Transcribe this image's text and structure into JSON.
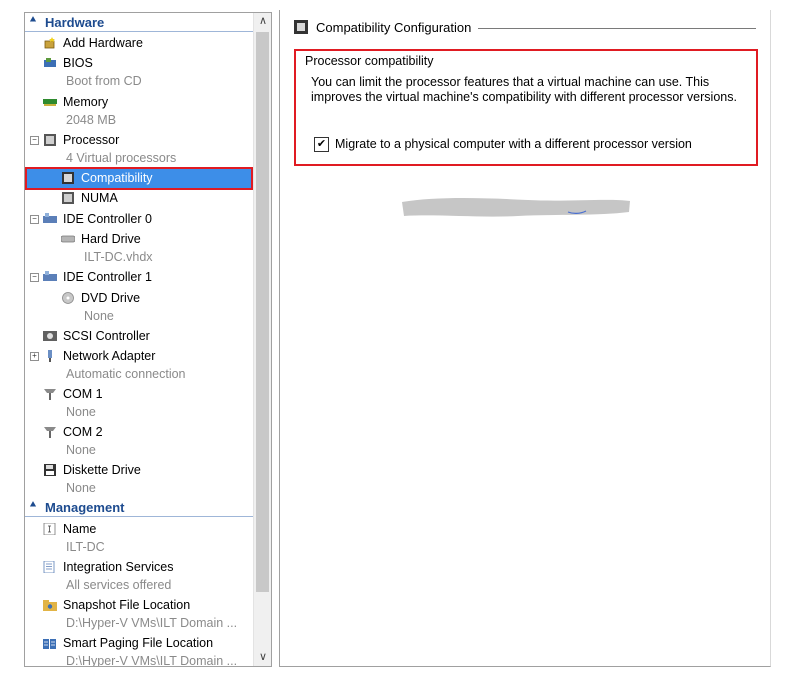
{
  "tree": {
    "hardware_section": "Hardware",
    "management_section": "Management",
    "items": {
      "add_hardware": "Add Hardware",
      "bios": "BIOS",
      "bios_sub": "Boot from CD",
      "memory": "Memory",
      "memory_sub": "2048 MB",
      "processor": "Processor",
      "processor_sub": "4 Virtual processors",
      "compatibility": "Compatibility",
      "numa": "NUMA",
      "ide0": "IDE Controller 0",
      "hard_drive": "Hard Drive",
      "hard_drive_sub": "ILT-DC.vhdx",
      "ide1": "IDE Controller 1",
      "dvd_drive": "DVD Drive",
      "dvd_sub": "None",
      "scsi": "SCSI Controller",
      "network": "Network Adapter",
      "network_sub": "Automatic connection",
      "com1": "COM 1",
      "com1_sub": "None",
      "com2": "COM 2",
      "com2_sub": "None",
      "diskette": "Diskette Drive",
      "diskette_sub": "None",
      "name": "Name",
      "name_sub": "ILT-DC",
      "integration": "Integration Services",
      "integration_sub": "All services offered",
      "snapshot": "Snapshot File Location",
      "snapshot_sub": "D:\\Hyper-V VMs\\ILT Domain ...",
      "paging": "Smart Paging File Location",
      "paging_sub": "D:\\Hyper-V VMs\\ILT Domain ..."
    }
  },
  "panel": {
    "title": "Compatibility Configuration",
    "group_title": "Processor compatibility",
    "description": "You can limit the processor features that a virtual machine can use. This improves the virtual machine's compatibility with different processor versions.",
    "checkbox_label": "Migrate to a physical computer with a different processor version",
    "checkbox_checked": true,
    "checkbox_glyph": "✔"
  },
  "colors": {
    "selection": "#3d8ee8",
    "highlight_border": "#e01b22",
    "section_header": "#1d4b8f"
  }
}
